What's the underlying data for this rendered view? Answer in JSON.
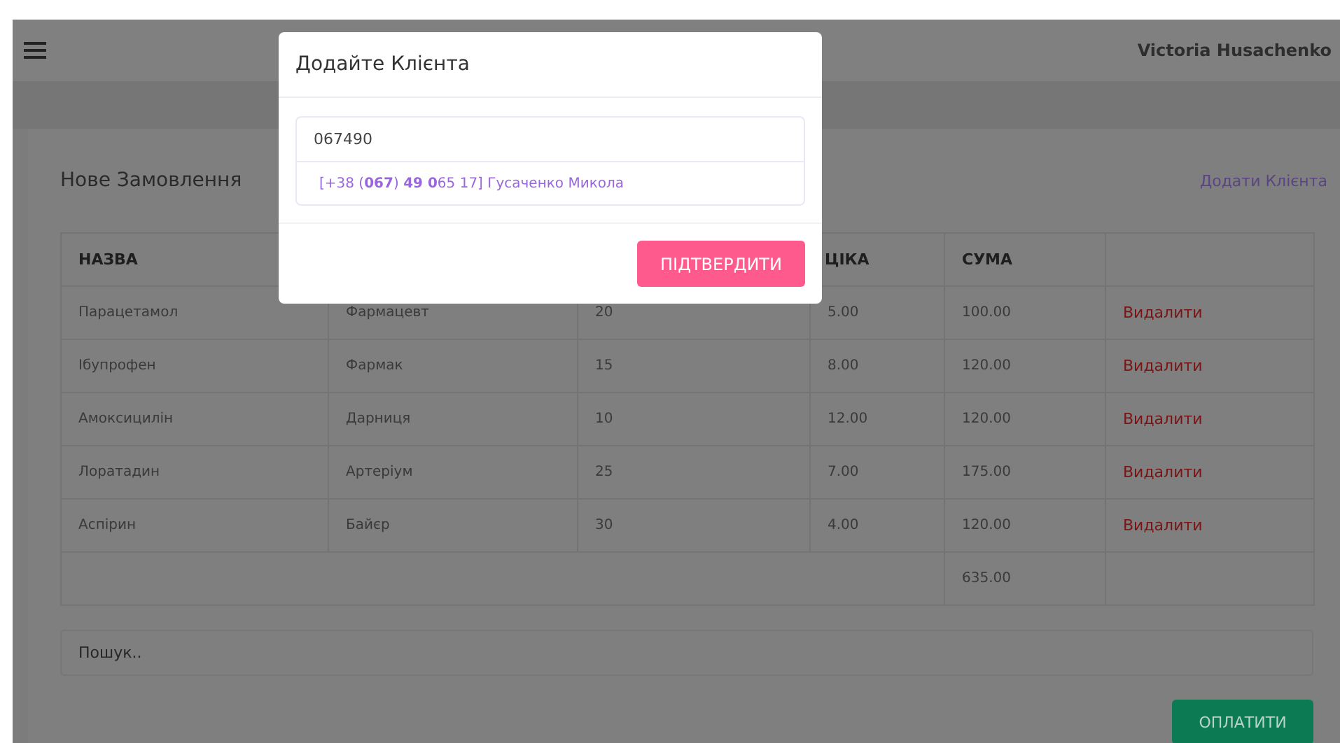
{
  "header": {
    "user": "Victoria Husachenko"
  },
  "order": {
    "title": "Нове Замовлення",
    "add_client_link": "Додати Клієнта",
    "columns": [
      "НАЗВА",
      null,
      null,
      "ЦІКА",
      "СУМА",
      null
    ],
    "rows": [
      {
        "cells": [
          "Парацетамол",
          "Фармацевт",
          "20",
          "5.00",
          "100.00"
        ],
        "action": "Видалити"
      },
      {
        "cells": [
          "Ібупрофен",
          "Фармак",
          "15",
          "8.00",
          "120.00"
        ],
        "action": "Видалити"
      },
      {
        "cells": [
          "Амоксицилін",
          "Дарниця",
          "10",
          "12.00",
          "120.00"
        ],
        "action": "Видалити"
      },
      {
        "cells": [
          "Лоратадин",
          "Артеріум",
          "25",
          "7.00",
          "175.00"
        ],
        "action": "Видалити"
      },
      {
        "cells": [
          "Аспірин",
          "Байєр",
          "30",
          "4.00",
          "120.00"
        ],
        "action": "Видалити"
      }
    ],
    "total": "635.00",
    "search": {
      "placeholder": "Пошук.."
    },
    "pay_button": "ОПЛАТИТИ"
  },
  "modal": {
    "title": "Додайте Клієнта",
    "input": "067490",
    "suggestion": "[+38 (**067**) **49 0**65 17] Гусаченко Микола",
    "confirm_button": "ПІДТВЕРДИТИ"
  }
}
